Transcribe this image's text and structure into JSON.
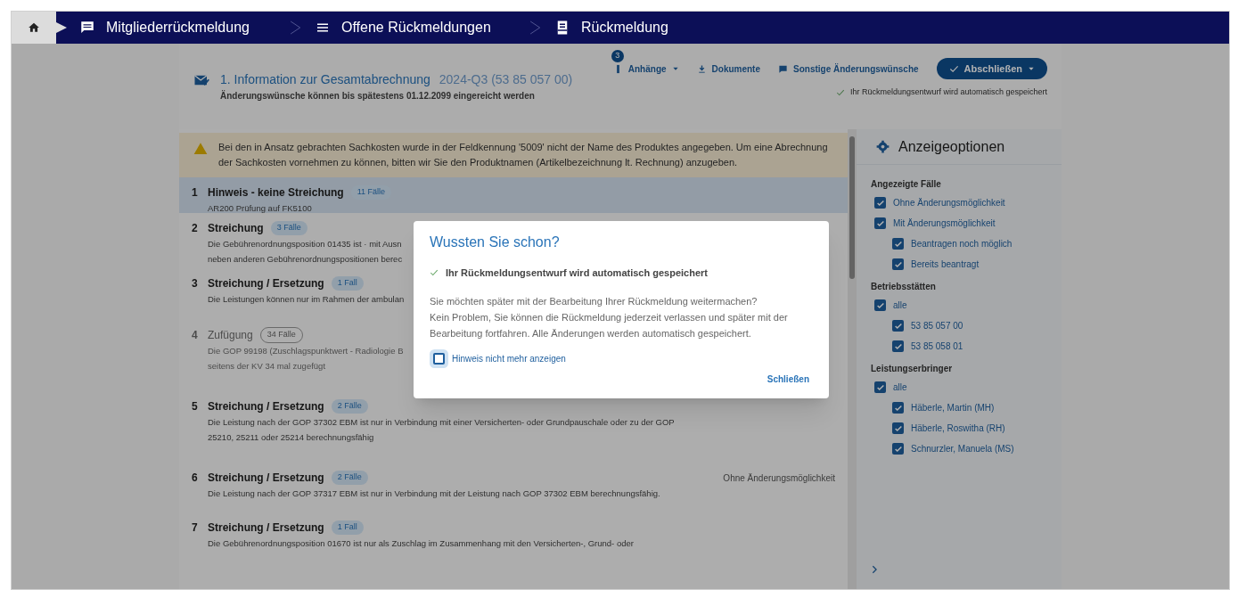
{
  "breadcrumb": [
    {
      "kind": "home"
    },
    {
      "kind": "feedback",
      "label": "Mitgliederrückmeldung"
    },
    {
      "kind": "list",
      "label": "Offene Rückmeldungen"
    },
    {
      "kind": "form",
      "label": "Rückmeldung"
    }
  ],
  "header": {
    "title": "1. Information zur Gesamtabrechnung",
    "period": "2024-Q3 (53 85 057 00)",
    "subtitle": "Änderungswünsche können bis spätestens 01.12.2099 eingereicht werden",
    "actions": [
      {
        "kind": "attachments",
        "label": "Anhänge",
        "badge": "3"
      },
      {
        "kind": "documents",
        "label": "Dokumente"
      },
      {
        "kind": "requests",
        "label": "Sonstige Änderungswünsche"
      }
    ],
    "primary_button": "Abschließen",
    "autosave_note": "Ihr Rückmeldungsentwurf wird automatisch gespeichert"
  },
  "warning": "Bei den in Ansatz gebrachten Sachkosten wurde in der Feldkennung '5009' nicht der Name des Produktes angegeben. Um eine Abrechnung der Sachkosten vornehmen zu können, bitten wir Sie den Produktnamen (Artikelbezeichnung lt. Rechnung) anzugeben.",
  "items": [
    {
      "number": "1",
      "title": "Hinweis - keine Streichung",
      "badge": "11 Fälle",
      "lines": [
        "AR200 Prüfung auf FK5100"
      ],
      "selected": true,
      "disabled": false
    },
    {
      "number": "2",
      "title": "Streichung",
      "badge": "3 Fälle",
      "lines": [
        "Die Gebührenordnungsposition 01435 ist · mit Ausn",
        "neben anderen Gebührenordnungspositionen berec"
      ],
      "selected": false,
      "disabled": false
    },
    {
      "number": "3",
      "title": "Streichung / Ersetzung",
      "badge": "1 Fall",
      "lines": [
        "Die Leistungen können nur im Rahmen der ambulan"
      ],
      "selected": false,
      "disabled": false
    },
    {
      "number": "4",
      "title": "Zufügung",
      "badge": "34 Fälle",
      "lines": [
        "Die GOP 99198 (Zuschlagspunktwert - Radiologie B",
        "seitens der KV 34 mal zugefügt"
      ],
      "selected": false,
      "disabled": true
    },
    {
      "number": "5",
      "title": "Streichung / Ersetzung",
      "badge": "2 Fälle",
      "lines": [
        "Die Leistung nach der GOP 37302 EBM ist nur in Verbindung mit einer Versicherten- oder Grundpauschale oder zu der GOP",
        "25210, 25211 oder 25214 berechnungsfähig"
      ],
      "selected": false,
      "disabled": false
    },
    {
      "number": "6",
      "title": "Streichung / Ersetzung",
      "badge": "2 Fälle",
      "lines": [
        "Die Leistung nach der GOP 37317 EBM ist nur in Verbindung mit der Leistung nach GOP 37302 EBM berechnungsfähig."
      ],
      "status": "Ohne Änderungsmöglichkeit",
      "selected": false,
      "disabled": false
    },
    {
      "number": "7",
      "title": "Streichung / Ersetzung",
      "badge": "1 Fall",
      "lines": [
        "Die Gebührenordnungsposition 01670 ist nur als Zuschlag im Zusammenhang mit den Versicherten-, Grund- oder"
      ],
      "selected": false,
      "disabled": false
    }
  ],
  "options": {
    "title": "Anzeigeoptionen",
    "groups": [
      {
        "label": "Angezeigte Fälle",
        "options": [
          {
            "label": "Ohne Änderungsmöglichkeit",
            "checked": true
          },
          {
            "label": "Mit Änderungsmöglichkeit",
            "checked": true,
            "children": [
              {
                "label": "Beantragen noch möglich",
                "checked": true
              },
              {
                "label": "Bereits beantragt",
                "checked": true
              }
            ]
          }
        ]
      },
      {
        "label": "Betriebsstätten",
        "options": [
          {
            "label": "alle",
            "checked": true,
            "children": [
              {
                "label": "53 85 057 00",
                "checked": true
              },
              {
                "label": "53 85 058 01",
                "checked": true
              }
            ]
          }
        ]
      },
      {
        "label": "Leistungserbringer",
        "options": [
          {
            "label": "alle",
            "checked": true,
            "children": [
              {
                "label": "Häberle, Martin (MH)",
                "checked": true
              },
              {
                "label": "Häberle, Roswitha (RH)",
                "checked": true
              },
              {
                "label": "Schnurzler, Manuela (MS)",
                "checked": true
              }
            ]
          }
        ]
      }
    ]
  },
  "dialog": {
    "title": "Wussten Sie schon?",
    "note": "Ihr Rückmeldungsentwurf wird automatisch gespeichert",
    "paragraphs": [
      "Sie möchten später mit der Bearbeitung Ihrer Rückmeldung weitermachen?",
      "Kein Problem, Sie können die Rückmeldung jederzeit verlassen und später mit der Bearbeitung fortfahren. Alle Änderungen werden automatisch gespeichert."
    ],
    "checkbox": {
      "label": "Hinweis nicht mehr anzeigen",
      "checked": false
    },
    "close_button": "Schließen"
  }
}
